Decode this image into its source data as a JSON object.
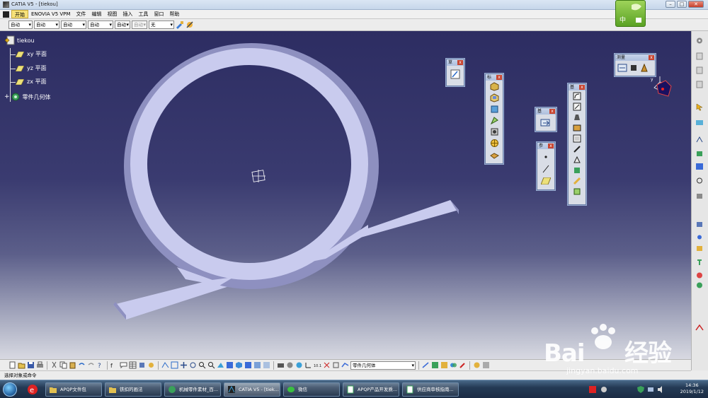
{
  "window": {
    "title": "CATIA V5 - [tiekou]",
    "minimize": "–",
    "maximize": "□",
    "close": "✕"
  },
  "menu": [
    "开始",
    "ENOVIA V5 VPM",
    "文件",
    "编辑",
    "视图",
    "插入",
    "工具",
    "窗口",
    "帮助"
  ],
  "style_toolbar": {
    "combos": [
      "自动",
      "自动",
      "自动",
      "自动",
      "自动"
    ],
    "disabled_combo": "自动",
    "layer_combo": "无"
  },
  "spec_tree": {
    "root": "tiekou",
    "items": [
      "xy 平面",
      "yz 平面",
      "zx 平面",
      "零件几何体"
    ]
  },
  "floating_toolbars": {
    "measure": {
      "title": "测量"
    },
    "sketcher": {
      "title": "草"
    },
    "features": {
      "title": "基"
    },
    "standard_a": {
      "title": "基"
    },
    "standard_b": {
      "title": "标"
    },
    "reference": {
      "title": "参"
    }
  },
  "bottom_toolbar": {
    "current_body": "零件几何体"
  },
  "status_bar": {
    "prompt": "选择对象或命令"
  },
  "taskbar": {
    "tasks": [
      {
        "label": "APQP文件包"
      },
      {
        "label": "铁扣的画法"
      },
      {
        "label": "机械零件素材_百..."
      },
      {
        "label": "CATIA V5 - [tiek..."
      },
      {
        "label": "微信"
      },
      {
        "label": "APQP产品开发质..."
      },
      {
        "label": "供应商审核指南..."
      }
    ],
    "time": "14:36",
    "date": "2019/1/12"
  },
  "ime": {
    "label": "中"
  },
  "watermark": {
    "brand": "Bai",
    "brand_suffix": "经验",
    "url": "jingyan.baidu.com"
  },
  "colors": {
    "viewport_top": "#2d2d62",
    "viewport_bottom": "#d8d9e2",
    "part_face": "#c9cbee",
    "part_shade": "#8e90c0",
    "ime_green": "#7bbf3a"
  }
}
